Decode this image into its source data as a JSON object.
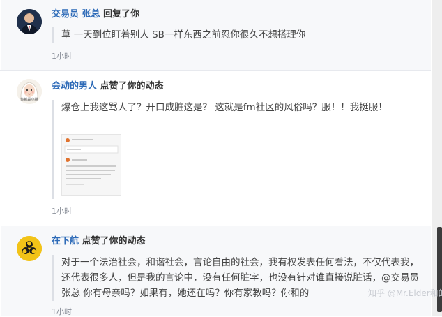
{
  "notifications": [
    {
      "user": "交易员 张总",
      "action": "回复了你",
      "text": "草 一天到位盯着别人 SB一样东西之前忍你很久不想搭理你",
      "time": "1小时",
      "avatar_icon": "man-in-suit-avatar"
    },
    {
      "user": "会动的男人",
      "action": "点赞了你的动态",
      "text": "爆仓上我这骂人了？开口成脏这是？ 这就是fm社区的风俗吗？服！！我挺服！",
      "time": "1小时",
      "avatar_icon": "cartoon-girl-avatar",
      "avatar_text": "你就是小猫"
    },
    {
      "user": "在下航",
      "action": "点赞了你的动态",
      "text": "对于一个法治社会，和谐社会，言论自由的社会，我有权发表任何看法，不仅代表我，还代表很多人，但是我的言论中，没有任何脏字，也没有针对谁直接说脏话，@交易员 张总 你有母亲吗？如果有，她还在吗？你有家教吗？你和的",
      "time": "1小时",
      "avatar_icon": "biohazard-avatar"
    }
  ],
  "watermark": "知乎 @Mr.Elder和的",
  "colors": {
    "username": "#2e6bb8",
    "item_background": "#f7f8fa"
  }
}
